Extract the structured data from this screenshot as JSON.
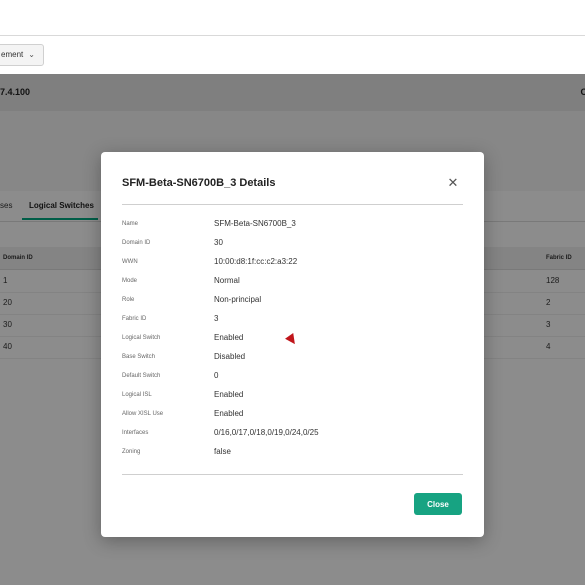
{
  "toolbar": {
    "management_label": "ement",
    "chevron_icon": "chevron-down-icon"
  },
  "header": {
    "ip_text": "7.4.100",
    "right_text": "C"
  },
  "tabs": [
    {
      "label": "ses"
    },
    {
      "label": "Logical Switches"
    }
  ],
  "table": {
    "headers": {
      "domain_id": "Domain ID",
      "fabric_id": "Fabric ID"
    },
    "rows": [
      {
        "domain_id": "1",
        "fabric_id": "128"
      },
      {
        "domain_id": "20",
        "fabric_id": "2"
      },
      {
        "domain_id": "30",
        "fabric_id": "3"
      },
      {
        "domain_id": "40",
        "fabric_id": "4"
      }
    ]
  },
  "modal": {
    "title": "SFM-Beta-SN6700B_3 Details",
    "close_icon": "close-icon",
    "details": [
      {
        "label": "Name",
        "value": "SFM-Beta-SN6700B_3"
      },
      {
        "label": "Domain ID",
        "value": "30"
      },
      {
        "label": "WWN",
        "value": "10:00:d8:1f:cc:c2:a3:22"
      },
      {
        "label": "Mode",
        "value": "Normal"
      },
      {
        "label": "Role",
        "value": "Non-principal"
      },
      {
        "label": "Fabric ID",
        "value": "3"
      },
      {
        "label": "Logical Switch",
        "value": "Enabled"
      },
      {
        "label": "Base Switch",
        "value": "Disabled"
      },
      {
        "label": "Default Switch",
        "value": "0"
      },
      {
        "label": "Logical ISL",
        "value": "Enabled"
      },
      {
        "label": "Allow XISL Use",
        "value": "Enabled"
      },
      {
        "label": "Interfaces",
        "value": "0/16,0/17,0/18,0/19,0/24,0/25"
      },
      {
        "label": "Zoning",
        "value": "false"
      }
    ],
    "close_button": "Close"
  }
}
